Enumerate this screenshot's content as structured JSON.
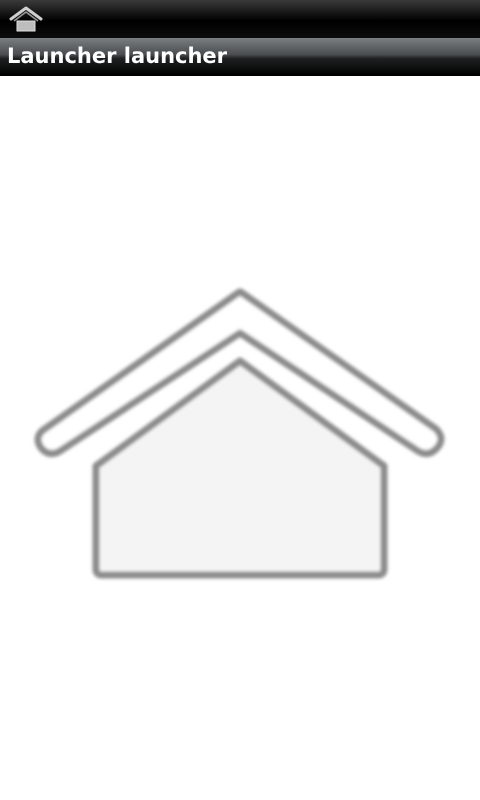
{
  "status_bar": {
    "icon": "home-icon"
  },
  "title_bar": {
    "title": "Launcher launcher"
  },
  "main": {
    "launcher_icon": "home-icon"
  },
  "colors": {
    "status_bar_bg": "#000000",
    "title_bar_bg": "#3f4244",
    "title_text": "#ffffff",
    "content_bg": "#ffffff",
    "icon_stroke": "#8c8c8c"
  }
}
